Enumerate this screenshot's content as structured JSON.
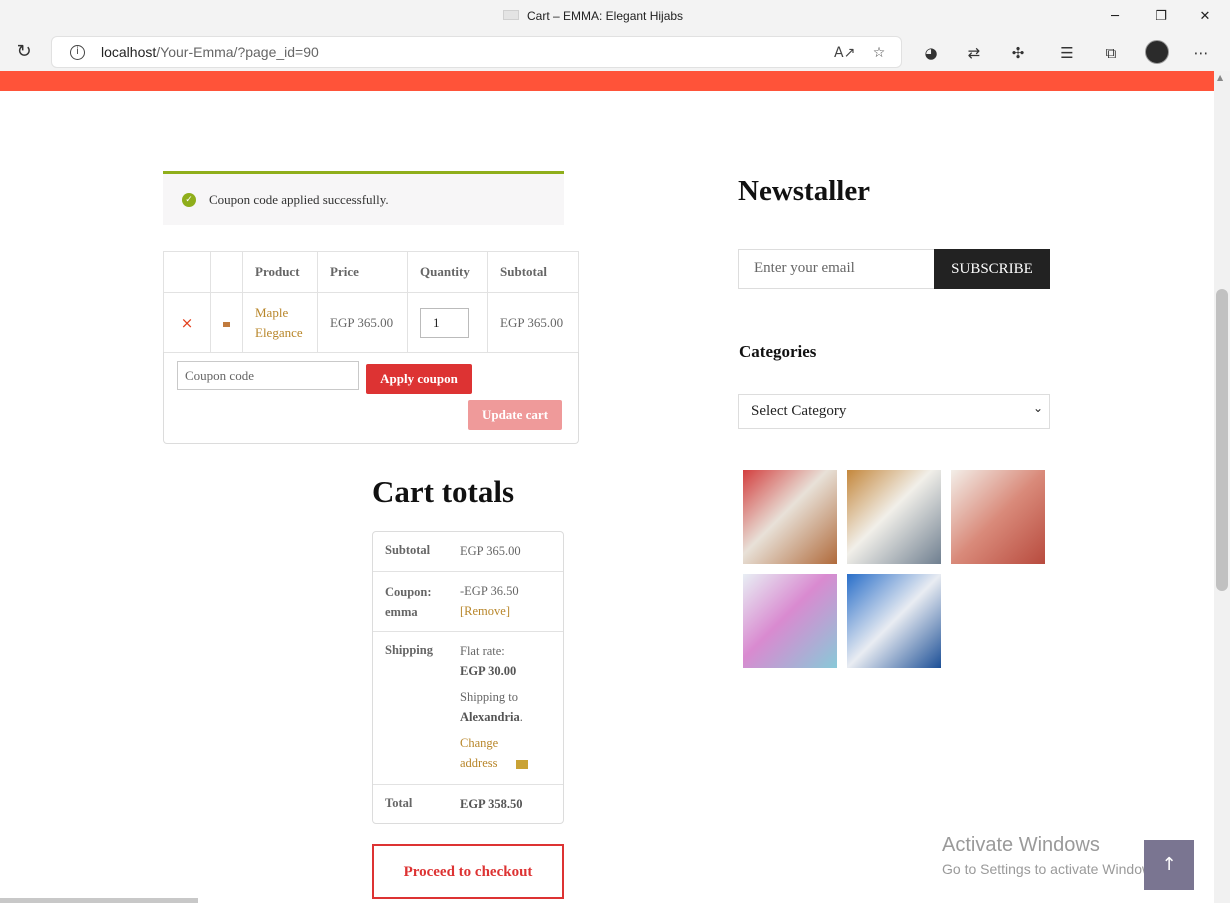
{
  "browser": {
    "window_title": "Cart – EMMA: Elegant Hijabs",
    "url_host": "localhost",
    "url_path": "/Your-Emma/?page_id=90"
  },
  "colors": {
    "accent_bar": "#ff5339",
    "button_red": "#dd3333",
    "success_green": "#8fae1b",
    "link_gold": "#b8862a"
  },
  "notice": {
    "message": "Coupon code applied successfully."
  },
  "cart": {
    "headers": [
      "",
      "",
      "Product",
      "Price",
      "Quantity",
      "Subtotal"
    ],
    "items": [
      {
        "remove": "×",
        "product": "Maple Elegance",
        "price": "EGP 365.00",
        "quantity": "1",
        "subtotal": "EGP 365.00"
      }
    ],
    "coupon_placeholder": "Coupon code",
    "apply_coupon_label": "Apply coupon",
    "update_cart_label": "Update cart"
  },
  "totals": {
    "heading": "Cart totals",
    "subtotal_label": "Subtotal",
    "subtotal_value": "EGP 365.00",
    "coupon_label": "Coupon: emma",
    "coupon_value": "-EGP 36.50",
    "coupon_remove": "[Remove]",
    "shipping_label": "Shipping",
    "shipping_method": "Flat rate:",
    "shipping_cost": "EGP 30.00",
    "shipping_to": "Shipping to",
    "shipping_city": "Alexandria",
    "change_address": "Change address",
    "total_label": "Total",
    "total_value": "EGP 358.50",
    "checkout_label": "Proceed to checkout"
  },
  "sidebar": {
    "newsletter_heading": "Newstaller",
    "email_placeholder": "Enter your email",
    "subscribe_label": "SUBSCRIBE",
    "categories_heading": "Categories",
    "category_select_value": "Select Category"
  },
  "os_overlay": {
    "activate_title": "Activate Windows",
    "activate_sub": "Go to Settings to activate Windows."
  }
}
